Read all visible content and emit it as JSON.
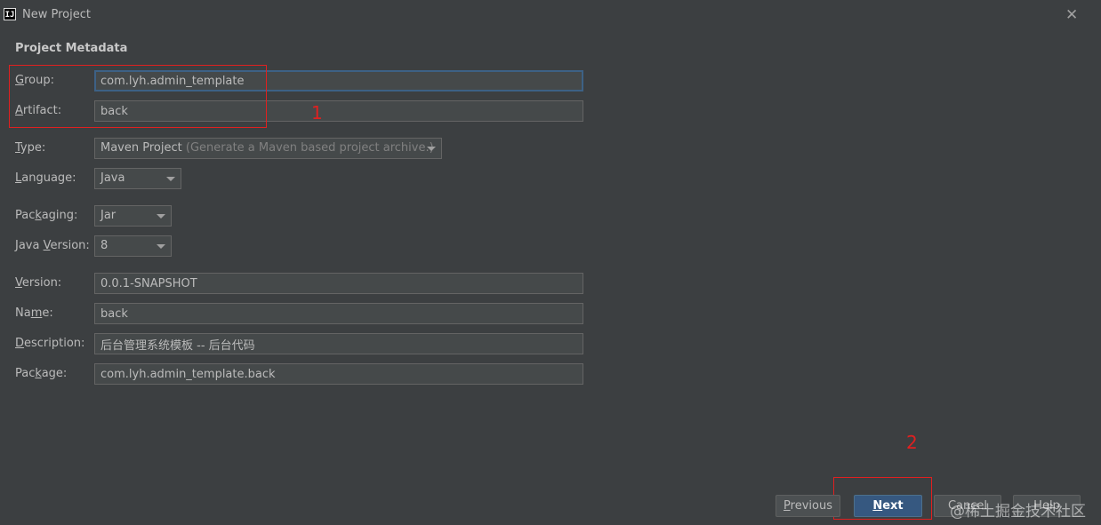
{
  "window": {
    "icon_text": "IJ",
    "title": "New Project",
    "close_glyph": "✕"
  },
  "section_title": "Project Metadata",
  "form": {
    "group": {
      "label_mn": "G",
      "label_rest": "roup:",
      "value": "com.lyh.admin_template"
    },
    "artifact": {
      "label_mn": "A",
      "label_rest": "rtifact:",
      "value": "back"
    },
    "type": {
      "label_mn": "T",
      "label_rest": "ype:",
      "value": "Maven Project",
      "hint": "(Generate a Maven based project archive.)"
    },
    "language": {
      "label_mn": "L",
      "label_rest": "anguage:",
      "value": "Java"
    },
    "packaging": {
      "label_pre": "Pac",
      "label_mn": "k",
      "label_rest": "aging:",
      "value": "Jar"
    },
    "java_version": {
      "label_pre": "Java ",
      "label_mn": "V",
      "label_rest": "ersion:",
      "value": "8"
    },
    "version": {
      "label_mn": "V",
      "label_rest": "ersion:",
      "value": "0.0.1-SNAPSHOT"
    },
    "name": {
      "label_pre": "Na",
      "label_mn": "m",
      "label_rest": "e:",
      "value": "back"
    },
    "description": {
      "label_mn": "D",
      "label_rest": "escription:",
      "value": "后台管理系统模板 -- 后台代码"
    },
    "package": {
      "label_pre": "Pac",
      "label_mn": "k",
      "label_rest": "age:",
      "value": "com.lyh.admin_template.back"
    }
  },
  "annotations": {
    "one": "1",
    "two": "2"
  },
  "buttons": {
    "previous": {
      "mn": "P",
      "rest": "revious"
    },
    "next": {
      "mn": "N",
      "rest": "ext"
    },
    "cancel": {
      "label": "Cancel"
    },
    "help": {
      "label": "Help"
    }
  },
  "watermark": "@稀土掘金技术社区",
  "colors": {
    "background": "#3c3f41",
    "field": "#45494a",
    "focus": "#3d6185",
    "primary_button": "#365880",
    "annotation": "#e02020"
  },
  "icons": [
    "intellij-app-icon",
    "close-icon",
    "chevron-down-icon"
  ]
}
